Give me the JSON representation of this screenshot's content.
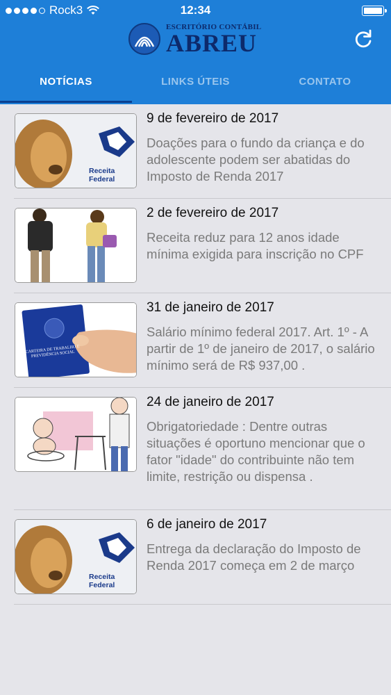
{
  "status_bar": {
    "carrier": "Rock3",
    "time": "12:34"
  },
  "header": {
    "logo_small": "ESCRITÓRIO CONTÁBIL",
    "logo_big": "ABREU",
    "refresh_icon": "refresh-icon"
  },
  "tabs": [
    {
      "label": "NOTÍCIAS",
      "active": true
    },
    {
      "label": "LINKS ÚTEIS",
      "active": false
    },
    {
      "label": "CONTATO",
      "active": false
    }
  ],
  "news": [
    {
      "date": "9 de fevereiro de 2017",
      "text": "Doações para o fundo da criança e do adolescente podem ser abatidas do Imposto de Renda 2017",
      "thumb": "receita-federal-lion",
      "thumb_label": "Receita Federal"
    },
    {
      "date": "2 de fevereiro de 2017",
      "text": "Receita reduz para 12 anos idade mínima exigida para inscrição no CPF",
      "thumb": "teenagers-illustration"
    },
    {
      "date": "31 de janeiro de 2017",
      "text": "Salário mínimo federal 2017. Art. 1º - A partir de 1º de janeiro de 2017, o salário mínimo será de R$ 937,00 .",
      "thumb": "work-card-hand",
      "thumb_label": "CARTEIRA DE TRABALHO E PREVIDÊNCIA SOCIAL"
    },
    {
      "date": "24 de janeiro de 2017",
      "text": "Obrigatoriedade  : Dentre outras situações  é oportuno mencionar que o fator \"idade\" do contribuinte não tem limite, restrição ou dispensa .",
      "thumb": "baby-elder-walkers"
    },
    {
      "date": "6 de janeiro de 2017",
      "text": "Entrega da declaração do Imposto de Renda 2017 começa em 2 de março",
      "thumb": "receita-federal-lion",
      "thumb_label": "Receita Federal"
    }
  ],
  "colors": {
    "header": "#1e7fd8",
    "tab_indicator": "#0a3f8f",
    "background": "#e5e5ea"
  }
}
